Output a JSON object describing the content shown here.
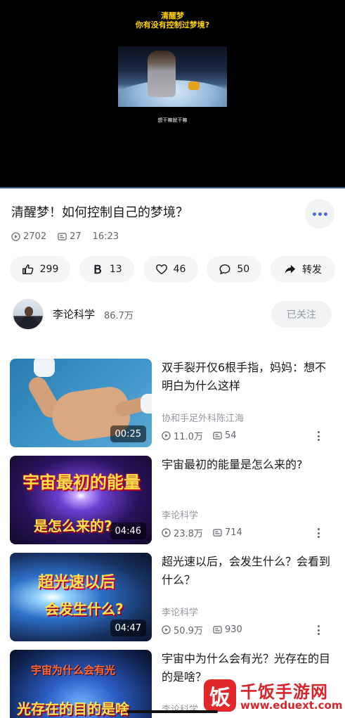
{
  "player": {
    "overlay_title_line1": "清醒梦",
    "overlay_title_line2": "你有没有控制过梦境?",
    "subtitle_caption": "想干嘛就干嘛"
  },
  "video": {
    "title": "清醒梦！如何控制自己的梦境？",
    "views": "2702",
    "danmaku": "27",
    "time": "16:23"
  },
  "actions": {
    "like_count": "299",
    "coin_count": "13",
    "favorite_count": "46",
    "comment_count": "50",
    "share_label": "转发"
  },
  "uploader": {
    "name": "李论科学",
    "followers": "86.7万",
    "follow_label": "已关注"
  },
  "recommendations": [
    {
      "title": "双手裂开仅6根手指，妈妈：想不明白为什么这样",
      "author": "协和手足外科陈江海",
      "views": "11.0万",
      "danmaku": "54",
      "duration": "00:25",
      "thumb_text_1": "",
      "thumb_text_2": ""
    },
    {
      "title": "宇宙最初的能量是怎么来的?",
      "author": "李论科学",
      "views": "23.8万",
      "danmaku": "714",
      "duration": "04:46",
      "thumb_text_1": "宇宙最初的能量",
      "thumb_text_2": "是怎么来的?"
    },
    {
      "title": "超光速以后，会发生什么？会看到什么？",
      "author": "李论科学",
      "views": "50.9万",
      "danmaku": "930",
      "duration": "04:47",
      "thumb_text_1": "超光速以后",
      "thumb_text_2": "会发生什么?"
    },
    {
      "title": "宇宙中为什么会有光？光存在的目的是啥？",
      "author": "李论科学",
      "views": "",
      "danmaku": "",
      "duration": "",
      "thumb_text_1": "宇宙为什么会有光",
      "thumb_text_2": "光存在的目的是啥"
    }
  ],
  "watermark": {
    "logo_char": "饭",
    "name": "千饭手游网",
    "url": "www.eduext.com"
  },
  "colors": {
    "accent_blue": "#4c6bd4",
    "watermark_red": "#d6262b",
    "title_yellow": "#ffd400"
  }
}
